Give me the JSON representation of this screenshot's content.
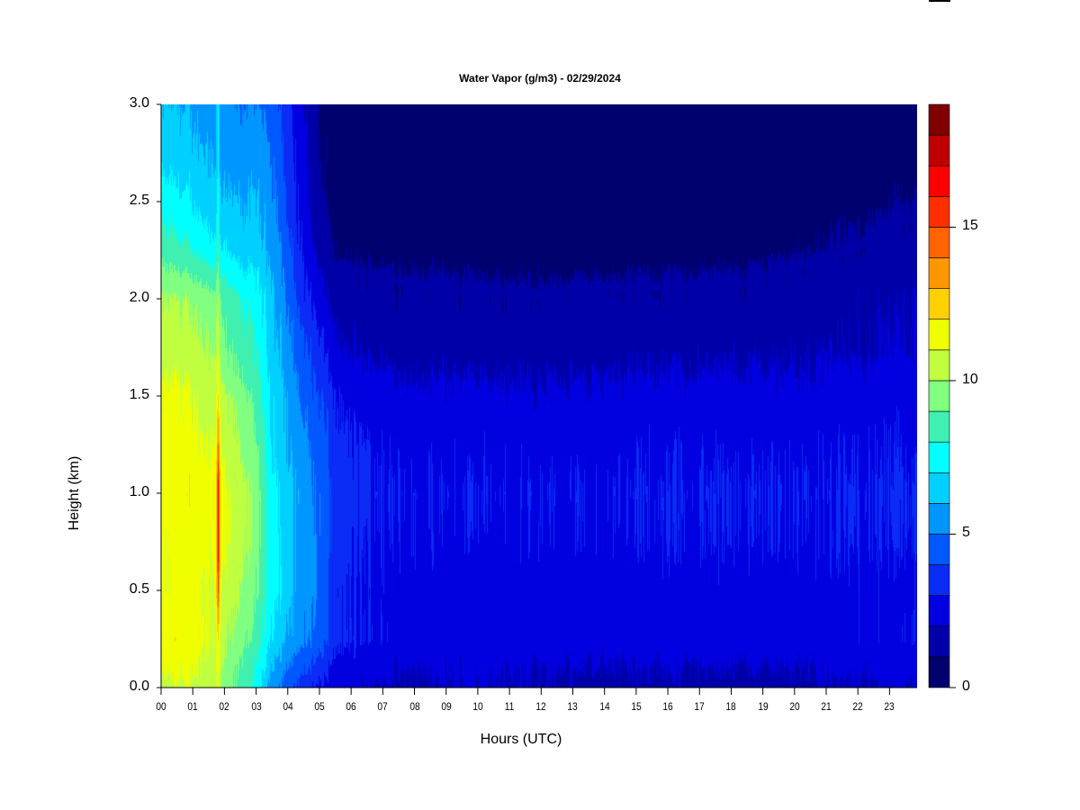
{
  "chart_data": {
    "type": "heatmap",
    "title": "Water Vapor (g/m3) - 02/29/2024",
    "xlabel": "Hours (UTC)",
    "ylabel": "Height (km)",
    "xlim": [
      0,
      23.87
    ],
    "ylim": [
      0,
      3.0
    ],
    "x_tick_values": [
      0,
      1,
      2,
      3,
      4,
      5,
      6,
      7,
      8,
      9,
      10,
      11,
      12,
      13,
      14,
      15,
      16,
      17,
      18,
      19,
      20,
      21,
      22,
      23
    ],
    "x_tick_labels": [
      "00",
      "01",
      "02",
      "03",
      "04",
      "05",
      "06",
      "07",
      "08",
      "09",
      "10",
      "11",
      "12",
      "13",
      "14",
      "15",
      "16",
      "17",
      "18",
      "19",
      "20",
      "21",
      "22",
      "23"
    ],
    "y_tick_values": [
      0,
      0.5,
      1.0,
      1.5,
      2.0,
      2.5,
      3.0
    ],
    "y_tick_labels": [
      "0.0",
      "0.5",
      "1.0",
      "1.5",
      "2.0",
      "2.5",
      "3.0"
    ],
    "colorbar": {
      "levels_min": 0,
      "levels_max": 19,
      "step": 1,
      "tick_values": [
        0,
        5,
        10,
        15
      ],
      "tick_labels": [
        "0",
        "5",
        "10",
        "15"
      ],
      "colors": [
        "#00006e",
        "#0000a8",
        "#0000e0",
        "#0a2cf5",
        "#0058ff",
        "#0096ff",
        "#00d0ff",
        "#00ffff",
        "#40f0b0",
        "#80ff80",
        "#c0ff40",
        "#f0ff00",
        "#ffd000",
        "#ff9800",
        "#ff6400",
        "#ff3000",
        "#ff0000",
        "#c00000",
        "#800000"
      ]
    },
    "grid_heights_km": [
      0,
      0.25,
      0.5,
      0.75,
      1.0,
      1.25,
      1.5,
      1.75,
      2.0,
      2.25,
      2.5,
      2.75,
      3.0
    ],
    "grid_hours": [
      0,
      0.5,
      1,
      1.5,
      1.72,
      1.79,
      1.86,
      2,
      2.5,
      3,
      3.5,
      4,
      4.5,
      5,
      5.5,
      6,
      8,
      10,
      12,
      14,
      16,
      18,
      20,
      22,
      23.9
    ],
    "values_by_hour": [
      [
        10.5,
        11.5,
        11,
        11,
        11.5,
        11.5,
        11,
        10.5,
        10,
        8.5,
        7.5,
        6.5,
        6
      ],
      [
        10.8,
        11.8,
        11.3,
        11.3,
        11.8,
        11.5,
        11.2,
        10.5,
        10,
        8.3,
        7.3,
        6.5,
        6
      ],
      [
        10.8,
        11.5,
        11.3,
        11.5,
        11.8,
        11.3,
        11,
        10.3,
        9.8,
        8,
        7,
        6.3,
        5.8
      ],
      [
        10.5,
        11,
        11,
        11.2,
        11.5,
        11,
        10.5,
        10,
        9.5,
        7.5,
        6.5,
        6,
        5.5
      ],
      [
        10.5,
        11,
        11.2,
        11.5,
        11.7,
        11.2,
        10.7,
        10,
        9.5,
        7.5,
        6.5,
        6,
        5.8
      ],
      [
        11.5,
        12,
        15,
        16.5,
        16.5,
        14,
        12,
        11,
        10,
        8.5,
        7.5,
        7,
        7
      ],
      [
        10,
        10.5,
        11,
        11.5,
        11.5,
        11,
        10.5,
        9.5,
        9,
        7,
        6,
        5.5,
        5.5
      ],
      [
        9.5,
        10,
        10.5,
        11,
        11,
        10.5,
        10,
        9,
        8.5,
        7,
        6,
        5.5,
        5.5
      ],
      [
        8.5,
        9.5,
        10,
        10.5,
        10.5,
        10,
        9.5,
        8.5,
        8,
        6.5,
        6,
        5.5,
        5
      ],
      [
        7.5,
        8.5,
        9,
        9.5,
        9.5,
        9,
        8.5,
        8,
        7.5,
        6.5,
        6,
        5.5,
        5
      ],
      [
        5.5,
        7,
        7.5,
        7.5,
        7.5,
        7,
        7,
        6.5,
        6.3,
        5.8,
        5.3,
        5,
        4.6
      ],
      [
        4.3,
        5.8,
        6.3,
        6.3,
        6.3,
        6,
        5.8,
        5.3,
        4.8,
        4.3,
        3.8,
        3.5,
        3.2
      ],
      [
        3.5,
        5.2,
        5.6,
        5.6,
        5.6,
        5.2,
        4.8,
        4.2,
        3.4,
        2.8,
        2.4,
        2.2,
        2.0
      ],
      [
        2.8,
        4.5,
        4.8,
        4.8,
        4.8,
        4.5,
        4.0,
        3.2,
        2.4,
        1.6,
        1.1,
        1.0,
        0.9
      ],
      [
        2.2,
        3.3,
        3.2,
        3.4,
        3.6,
        3.4,
        3.0,
        2.2,
        1.6,
        0.9,
        0.7,
        0.7,
        0.7
      ],
      [
        2.1,
        3.0,
        2.9,
        3.1,
        3.3,
        3.1,
        2.6,
        1.9,
        1.5,
        0.85,
        0.65,
        0.65,
        0.65
      ],
      [
        1.8,
        2.6,
        2.6,
        2.8,
        2.9,
        2.7,
        2.3,
        1.6,
        1.3,
        0.8,
        0.6,
        0.6,
        0.6
      ],
      [
        2.1,
        2.5,
        2.5,
        2.8,
        2.9,
        2.7,
        2.3,
        1.6,
        1.25,
        0.75,
        0.6,
        0.6,
        0.6
      ],
      [
        1.8,
        2.5,
        2.5,
        2.8,
        2.9,
        2.7,
        2.2,
        1.5,
        1.2,
        0.7,
        0.6,
        0.6,
        0.6
      ],
      [
        1.6,
        2.5,
        2.6,
        2.8,
        2.9,
        2.7,
        2.3,
        1.6,
        1.3,
        0.7,
        0.6,
        0.6,
        0.6
      ],
      [
        1.7,
        2.6,
        2.6,
        2.9,
        3.0,
        2.8,
        2.4,
        1.7,
        1.3,
        0.75,
        0.6,
        0.6,
        0.6
      ],
      [
        1.5,
        2.6,
        2.6,
        2.9,
        3.0,
        2.8,
        2.4,
        1.7,
        1.3,
        0.8,
        0.6,
        0.6,
        0.6
      ],
      [
        1.7,
        2.6,
        2.6,
        2.9,
        3.0,
        2.8,
        2.4,
        1.8,
        1.5,
        0.95,
        0.6,
        0.6,
        0.6
      ],
      [
        1.9,
        2.7,
        2.7,
        2.9,
        3.0,
        2.8,
        2.5,
        1.9,
        1.7,
        1.2,
        0.8,
        0.6,
        0.6
      ],
      [
        2.1,
        2.8,
        2.7,
        3.0,
        3.1,
        2.9,
        2.6,
        2.1,
        1.9,
        1.5,
        1.05,
        0.8,
        0.7
      ]
    ]
  }
}
